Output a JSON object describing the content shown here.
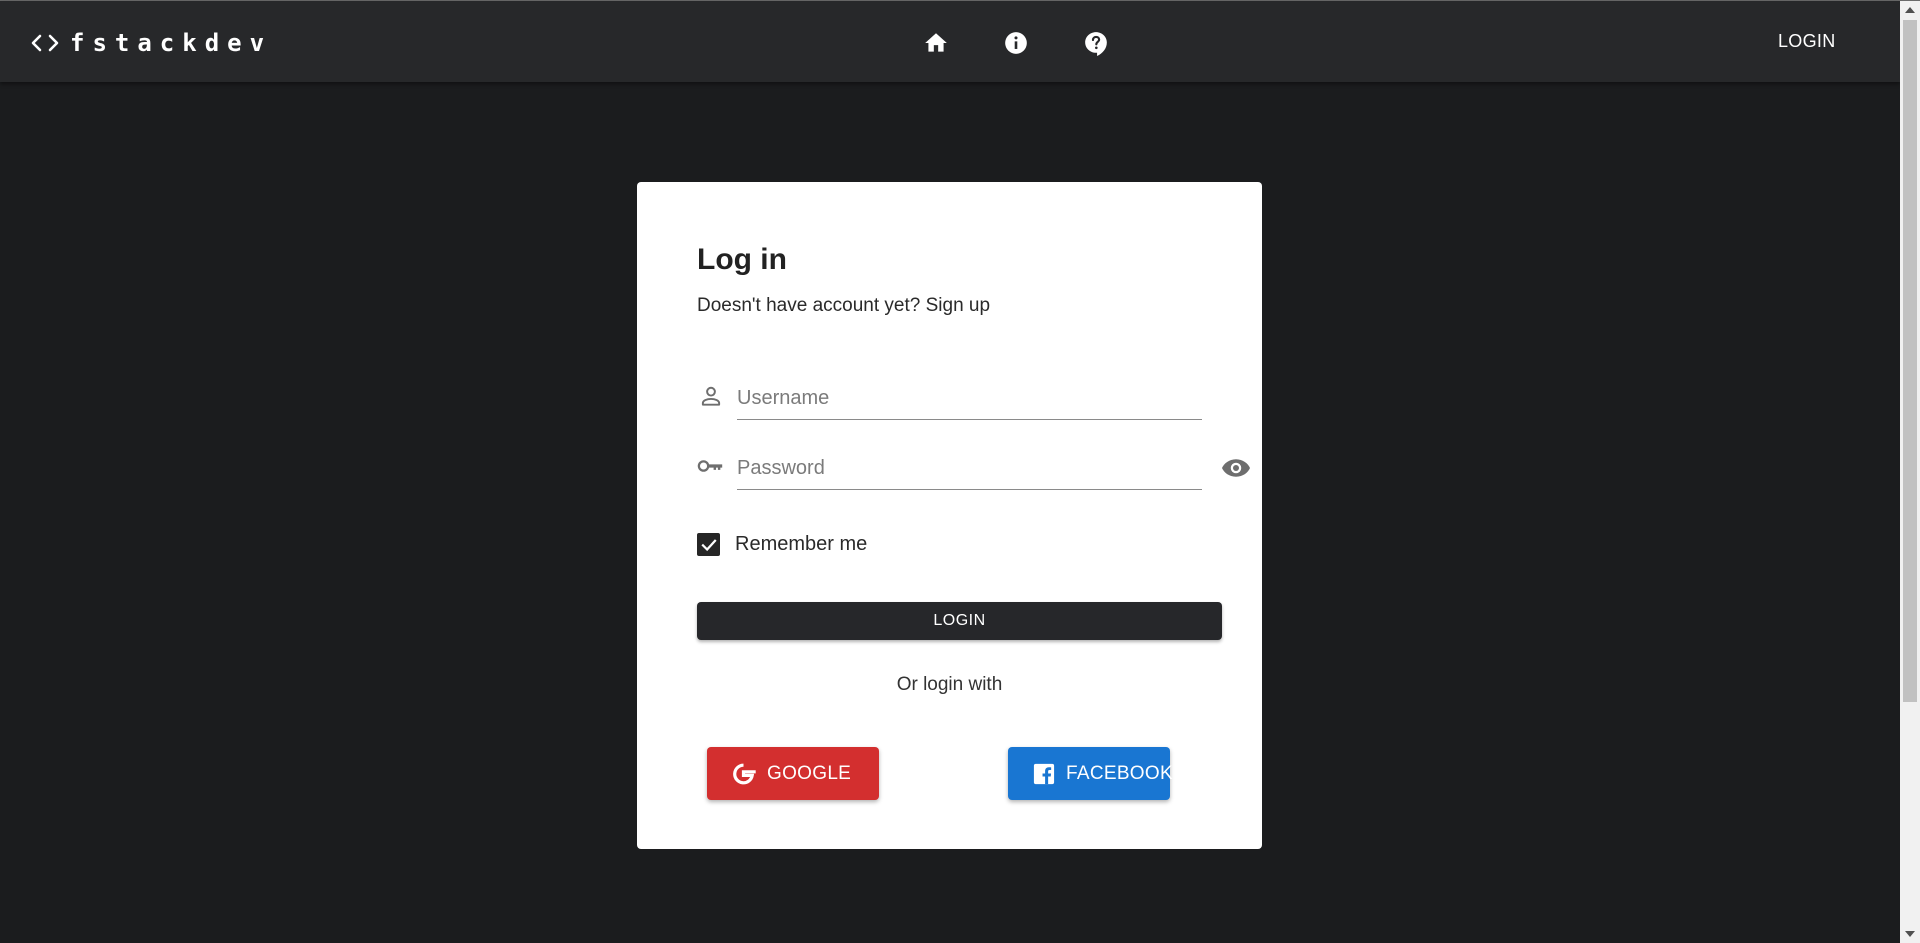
{
  "header": {
    "logo_text": "fstackdev",
    "logo_icon": "code-icon",
    "nav_icons": [
      "home-icon",
      "info-icon",
      "help-icon"
    ],
    "login_link": "LOGIN"
  },
  "card": {
    "title": "Log in",
    "subtitle": "Doesn't have account yet? Sign up",
    "username": {
      "value": "",
      "placeholder": "Username",
      "icon": "person-icon"
    },
    "password": {
      "value": "",
      "placeholder": "Password",
      "icon": "key-icon",
      "toggle_icon": "eye-icon"
    },
    "remember_label": "Remember me",
    "remember_checked": true,
    "login_button": "LOGIN",
    "or_text": "Or login with",
    "google_button": "GOOGLE",
    "facebook_button": "FACEBOOK"
  },
  "colors": {
    "page_bg": "#1b1c1e",
    "appbar_bg": "#27282a",
    "google": "#d32f2f",
    "facebook": "#1976d2",
    "login_button": "#26272a"
  }
}
